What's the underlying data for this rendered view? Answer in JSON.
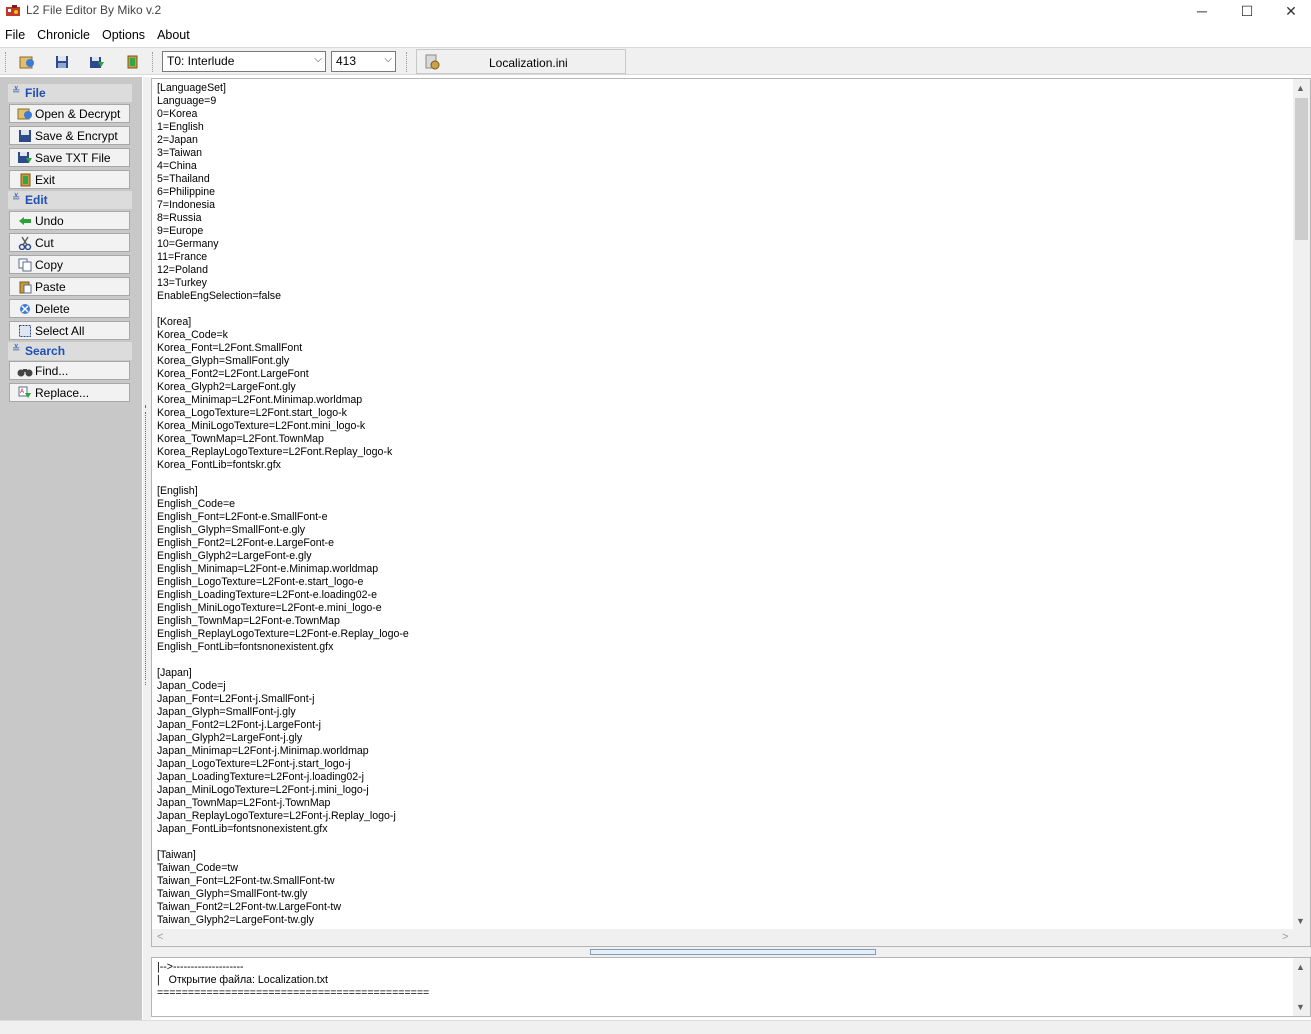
{
  "window": {
    "title": "L2 File Editor By Miko v.2",
    "min_glyph": "─",
    "max_glyph": "☐",
    "close_glyph": "✕"
  },
  "menu": [
    "File",
    "Chronicle",
    "Options",
    "About"
  ],
  "toolbar": {
    "chronicle_value": "T0: Interlude",
    "protocol_value": "413",
    "current_file": "Localization.ini",
    "dropdown_glyph": "⌵"
  },
  "sidebar": {
    "groups": [
      {
        "title": "File",
        "items": [
          "Open & Decrypt",
          "Save & Encrypt",
          "Save TXT File",
          "Exit"
        ]
      },
      {
        "title": "Edit",
        "items": [
          "Undo",
          "Cut",
          "Copy",
          "Paste",
          "Delete",
          "Select All"
        ]
      },
      {
        "title": "Search",
        "items": [
          "Find...",
          "Replace..."
        ]
      }
    ],
    "chevron_glyph": "≚"
  },
  "editor": {
    "content": "[LanguageSet]\nLanguage=9\n0=Korea\n1=English\n2=Japan\n3=Taiwan\n4=China\n5=Thailand\n6=Philippine\n7=Indonesia\n8=Russia\n9=Europe\n10=Germany\n11=France\n12=Poland\n13=Turkey\nEnableEngSelection=false\n\n[Korea]\nKorea_Code=k\nKorea_Font=L2Font.SmallFont\nKorea_Glyph=SmallFont.gly\nKorea_Font2=L2Font.LargeFont\nKorea_Glyph2=LargeFont.gly\nKorea_Minimap=L2Font.Minimap.worldmap\nKorea_LogoTexture=L2Font.start_logo-k\nKorea_MiniLogoTexture=L2Font.mini_logo-k\nKorea_TownMap=L2Font.TownMap\nKorea_ReplayLogoTexture=L2Font.Replay_logo-k\nKorea_FontLib=fontskr.gfx\n\n[English]\nEnglish_Code=e\nEnglish_Font=L2Font-e.SmallFont-e\nEnglish_Glyph=SmallFont-e.gly\nEnglish_Font2=L2Font-e.LargeFont-e\nEnglish_Glyph2=LargeFont-e.gly\nEnglish_Minimap=L2Font-e.Minimap.worldmap\nEnglish_LogoTexture=L2Font-e.start_logo-e\nEnglish_LoadingTexture=L2Font-e.loading02-e\nEnglish_MiniLogoTexture=L2Font-e.mini_logo-e\nEnglish_TownMap=L2Font-e.TownMap\nEnglish_ReplayLogoTexture=L2Font-e.Replay_logo-e\nEnglish_FontLib=fontsnonexistent.gfx\n\n[Japan]\nJapan_Code=j\nJapan_Font=L2Font-j.SmallFont-j\nJapan_Glyph=SmallFont-j.gly\nJapan_Font2=L2Font-j.LargeFont-j\nJapan_Glyph2=LargeFont-j.gly\nJapan_Minimap=L2Font-j.Minimap.worldmap\nJapan_LogoTexture=L2Font-j.start_logo-j\nJapan_LoadingTexture=L2Font-j.loading02-j\nJapan_MiniLogoTexture=L2Font-j.mini_logo-j\nJapan_TownMap=L2Font-j.TownMap\nJapan_ReplayLogoTexture=L2Font-j.Replay_logo-j\nJapan_FontLib=fontsnonexistent.gfx\n\n[Taiwan]\nTaiwan_Code=tw\nTaiwan_Font=L2Font-tw.SmallFont-tw\nTaiwan_Glyph=SmallFont-tw.gly\nTaiwan_Font2=L2Font-tw.LargeFont-tw\nTaiwan_Glyph2=LargeFont-tw.gly",
    "scroll_up": "▲",
    "scroll_down": "▼",
    "scroll_left": "<",
    "scroll_right": ">"
  },
  "log": {
    "content": "|-->--------------------\n|   Открытие файла: Localization.txt\n============================================"
  },
  "colors": {
    "sidebar_bg": "#c8c8c8",
    "group_title": "#1f4fb3",
    "toolbar_bg": "#f0f0f0"
  }
}
